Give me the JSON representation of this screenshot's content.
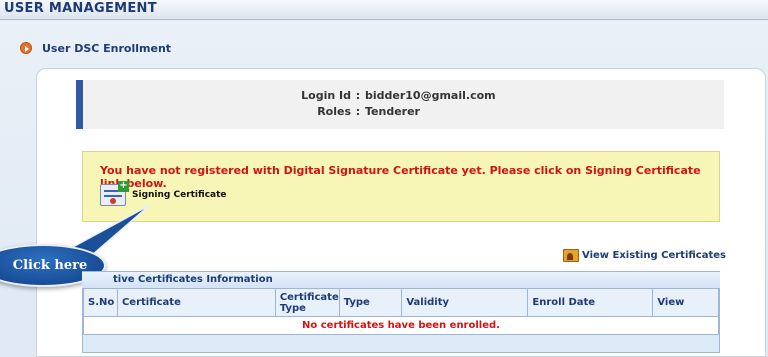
{
  "header": {
    "title": "USER MANAGEMENT"
  },
  "section": {
    "title": "User DSC Enrollment",
    "icon": "arrow-bullet-icon"
  },
  "user_info": {
    "login_label": "Login Id",
    "login_value": "bidder10@gmail.com",
    "roles_label": "Roles",
    "roles_value": "Tenderer",
    "separator": ":"
  },
  "warning": {
    "message": "You have not registered with Digital Signature Certificate yet. Please click on Signing Certificate link below.",
    "link_label": "Signing Certificate",
    "link_icon": "certificate-add-icon"
  },
  "callout": {
    "text": "Click here"
  },
  "view_existing": {
    "label": "View Existing Certificates",
    "icon": "certificate-folder-icon"
  },
  "active_certs": {
    "title_visible": "tive Certificates Information",
    "columns": [
      "S.No",
      "Certificate",
      "Certificate Type",
      "Type",
      "Validity",
      "Enroll Date",
      "View"
    ],
    "empty_message": "No certificates have been enrolled."
  },
  "colors": {
    "accent_blue": "#1d3b78",
    "bar_blue": "#2e5aa8",
    "warning_bg": "#f7f6b6",
    "warning_text": "#d01414",
    "bullet_orange": "#e8732a"
  }
}
